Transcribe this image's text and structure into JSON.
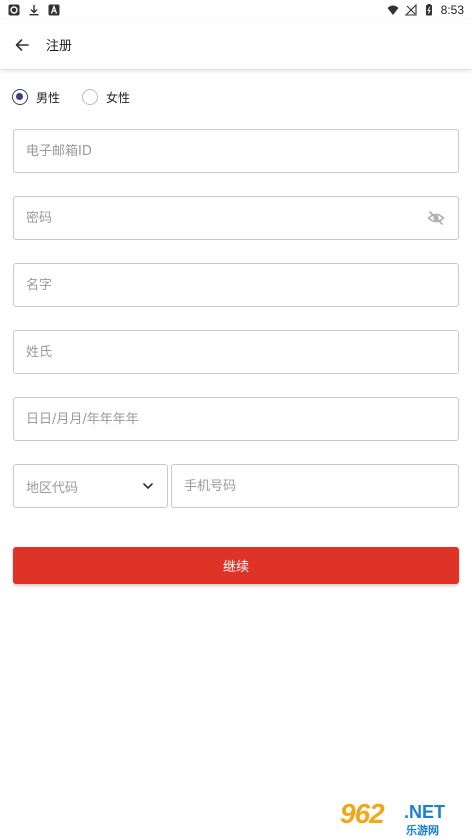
{
  "status_bar": {
    "time": "8:53"
  },
  "header": {
    "title": "注册"
  },
  "gender": {
    "options": [
      {
        "label": "男性",
        "checked": true
      },
      {
        "label": "女性",
        "checked": false
      }
    ]
  },
  "form": {
    "email_placeholder": "电子邮箱ID",
    "password_placeholder": "密码",
    "first_name_placeholder": "名字",
    "last_name_placeholder": "姓氏",
    "dob_placeholder": "日日/月月/年年年年",
    "region_code_placeholder": "地区代码",
    "phone_placeholder": "手机号码"
  },
  "actions": {
    "continue_label": "继续"
  },
  "watermark": {
    "brand": "962",
    "suffix": ".NET",
    "sub": "乐游网"
  },
  "colors": {
    "accent": "#3c3e7a",
    "primary_button": "#e03327"
  }
}
